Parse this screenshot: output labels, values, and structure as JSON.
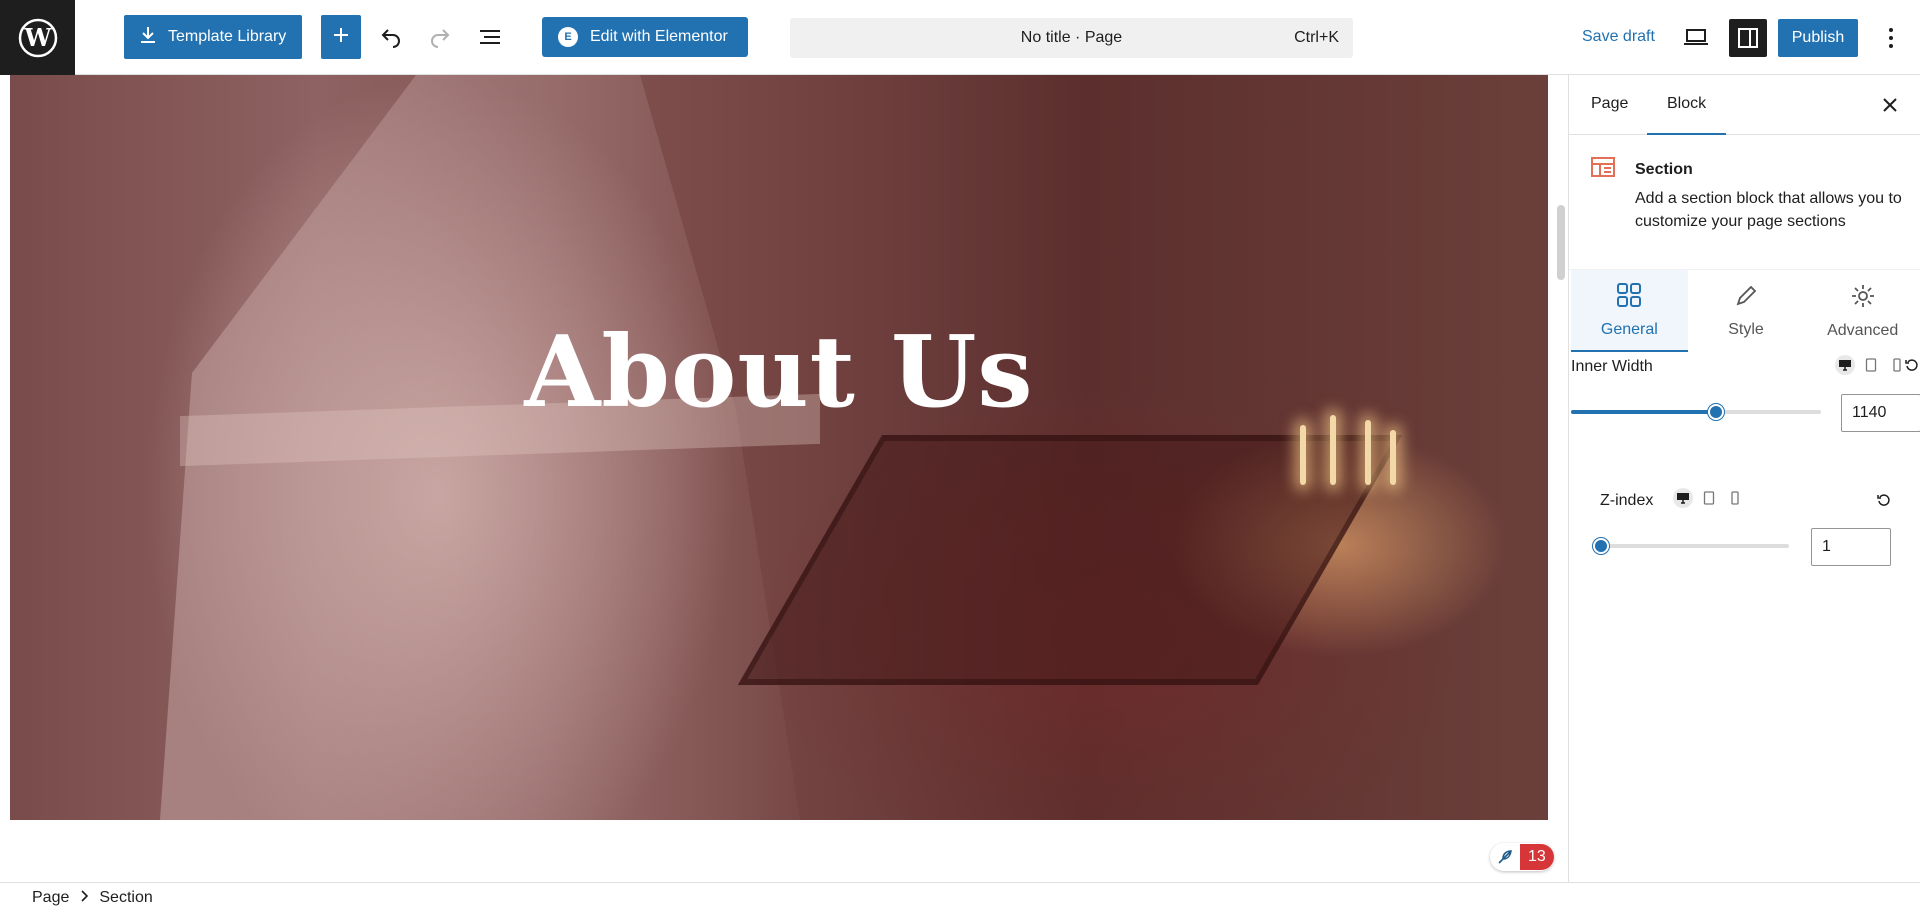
{
  "toolbar": {
    "template_library_label": "Template Library",
    "elementor_label": "Edit with Elementor",
    "elementor_badge": "E",
    "document_title": "No title · Page",
    "command_shortcut": "Ctrl+K",
    "save_draft_label": "Save draft",
    "publish_label": "Publish",
    "accent_color": "#2271b1"
  },
  "canvas": {
    "hero_title": "About Us",
    "notification_count": "13"
  },
  "sidebar": {
    "tabs": [
      "Page",
      "Block"
    ],
    "active_tab": "Block",
    "block": {
      "name": "Section",
      "description": "Add a section block that allows you to customize your page sections"
    },
    "subtabs": [
      {
        "label": "General",
        "icon": "grid-icon"
      },
      {
        "label": "Style",
        "icon": "pencil-icon"
      },
      {
        "label": "Advanced",
        "icon": "gear-icon"
      }
    ],
    "active_subtab": "General",
    "controls": {
      "inner_width": {
        "label": "Inner Width",
        "value": "1140",
        "fraction": 0.58
      },
      "z_index": {
        "label": "Z-index",
        "value": "1",
        "fraction": 0.0
      }
    }
  },
  "breadcrumb": {
    "items": [
      "Page",
      "Section"
    ]
  }
}
